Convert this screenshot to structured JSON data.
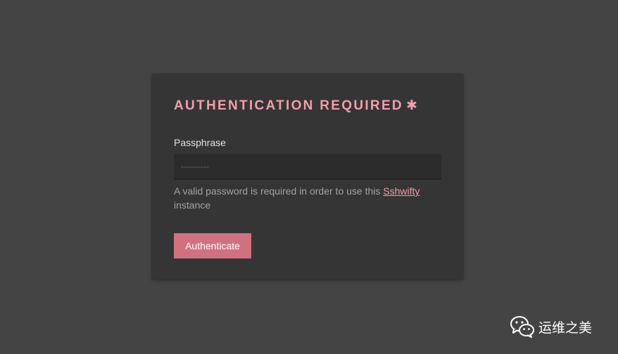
{
  "auth": {
    "title": "AUTHENTICATION REQUIRED",
    "title_marker": "✱",
    "field_label": "Passphrase",
    "input_placeholder": "----------",
    "hint_before_link": "A valid password is required in order to use this ",
    "hint_link": "Sshwifty",
    "hint_after_link": " instance",
    "button_label": "Authenticate"
  },
  "watermark": {
    "icon": "wechat-icon",
    "text": "运维之美"
  },
  "colors": {
    "page_background": "#444444",
    "window_background": "#353535",
    "accent": "#f39eaa",
    "button_background": "#d0717f",
    "input_background": "#2c2c2c"
  }
}
